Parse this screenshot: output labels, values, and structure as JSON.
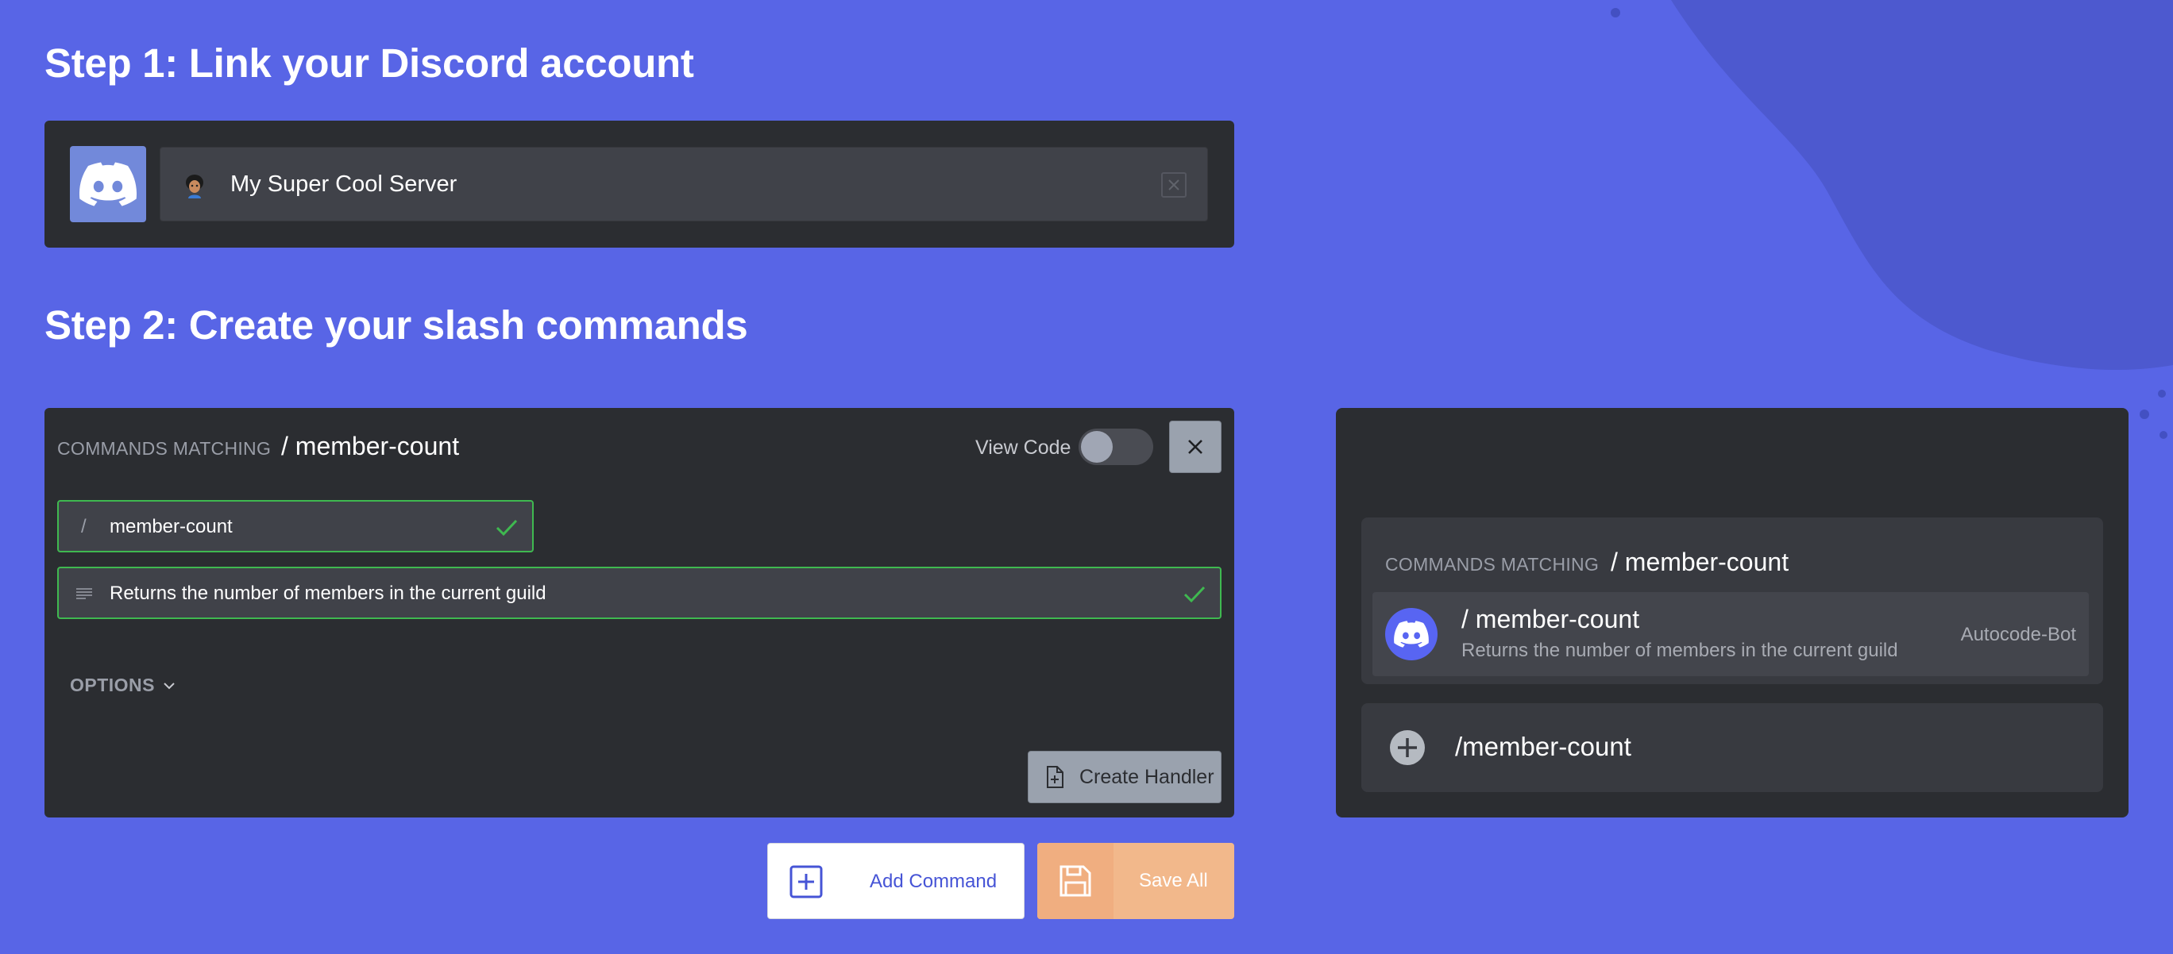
{
  "step1": {
    "title": "Step 1: Link your Discord account"
  },
  "server": {
    "name": "My Super Cool Server",
    "icon": "server-avatar-icon"
  },
  "step2": {
    "title": "Step 2: Create your slash commands"
  },
  "editor": {
    "commands_matching_label": "COMMANDS MATCHING",
    "commands_matching_value": "/ member-count",
    "view_code_label": "View Code",
    "view_code_enabled": false,
    "name_prefix": "/",
    "command_name": "member-count",
    "command_description": "Returns the number of members in the current guild",
    "options_label": "OPTIONS",
    "create_handler_label": "Create Handler"
  },
  "actions": {
    "add_command_label": "Add Command",
    "save_all_label": "Save All"
  },
  "preview": {
    "commands_matching_label": "COMMANDS MATCHING",
    "commands_matching_value": "/ member-count",
    "item_title": "/ member-count",
    "item_description": "Returns the number of members in the current guild",
    "item_bot": "Autocode-Bot",
    "input_text": "/member-count"
  },
  "colors": {
    "background": "#5865e6",
    "panel": "#2b2d31",
    "valid": "#3fb950",
    "discord_blurple": "#5865f2",
    "save_button": "#f2b88b"
  }
}
